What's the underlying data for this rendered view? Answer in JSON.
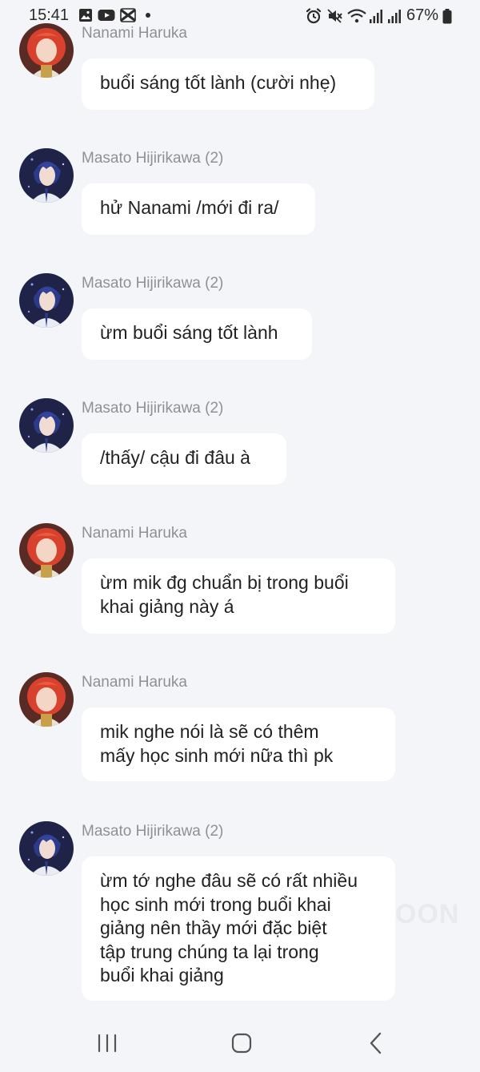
{
  "status_bar": {
    "time": "15:41",
    "battery_percent": "67%",
    "left_icons": [
      "gallery-icon",
      "youtube-icon",
      "capcut-icon",
      "notification-dot-icon"
    ],
    "right_icons": [
      "alarm-icon",
      "mute-icon",
      "wifi-icon",
      "signal-icon",
      "signal-icon",
      "battery-icon"
    ]
  },
  "messages": [
    {
      "sender": "Nanami Haruka",
      "text": "buổi sáng tốt lành (cười nhẹ)",
      "avatar": "nanami-avatar"
    },
    {
      "sender": "Masato Hijirikawa (2)",
      "text": "hử Nanami /mới đi ra/",
      "avatar": "masato-avatar"
    },
    {
      "sender": "Masato Hijirikawa (2)",
      "text": "ừm buổi sáng tốt lành",
      "avatar": "masato-avatar"
    },
    {
      "sender": "Masato Hijirikawa (2)",
      "text": "/thấy/ cậu đi đâu à",
      "avatar": "masato-avatar"
    },
    {
      "sender": "Nanami Haruka",
      "text": "ừm mik đg chuẩn bị trong buổi\nkhai giảng này á",
      "avatar": "nanami-avatar"
    },
    {
      "sender": "Nanami Haruka",
      "text": "mik nghe nói là sẽ có thêm\nmấy học sinh mới nữa thì pk",
      "avatar": "nanami-avatar"
    },
    {
      "sender": "Masato Hijirikawa (2)",
      "text": "ừm tớ nghe đâu sẽ có rất nhiều\nhọc sinh mới trong buổi khai\ngiảng nên thầy mới đặc biệt\ntập trung chúng ta lại trong\nbuổi khai giảng",
      "avatar": "masato-avatar"
    }
  ],
  "watermark": "OON",
  "nav_bar": {
    "buttons": [
      "recent-apps-icon",
      "home-icon",
      "back-icon"
    ]
  },
  "colors": {
    "background": "#f4f5f8",
    "bubble": "#ffffff",
    "sender_text": "#8d9196",
    "message_text": "#222222"
  }
}
